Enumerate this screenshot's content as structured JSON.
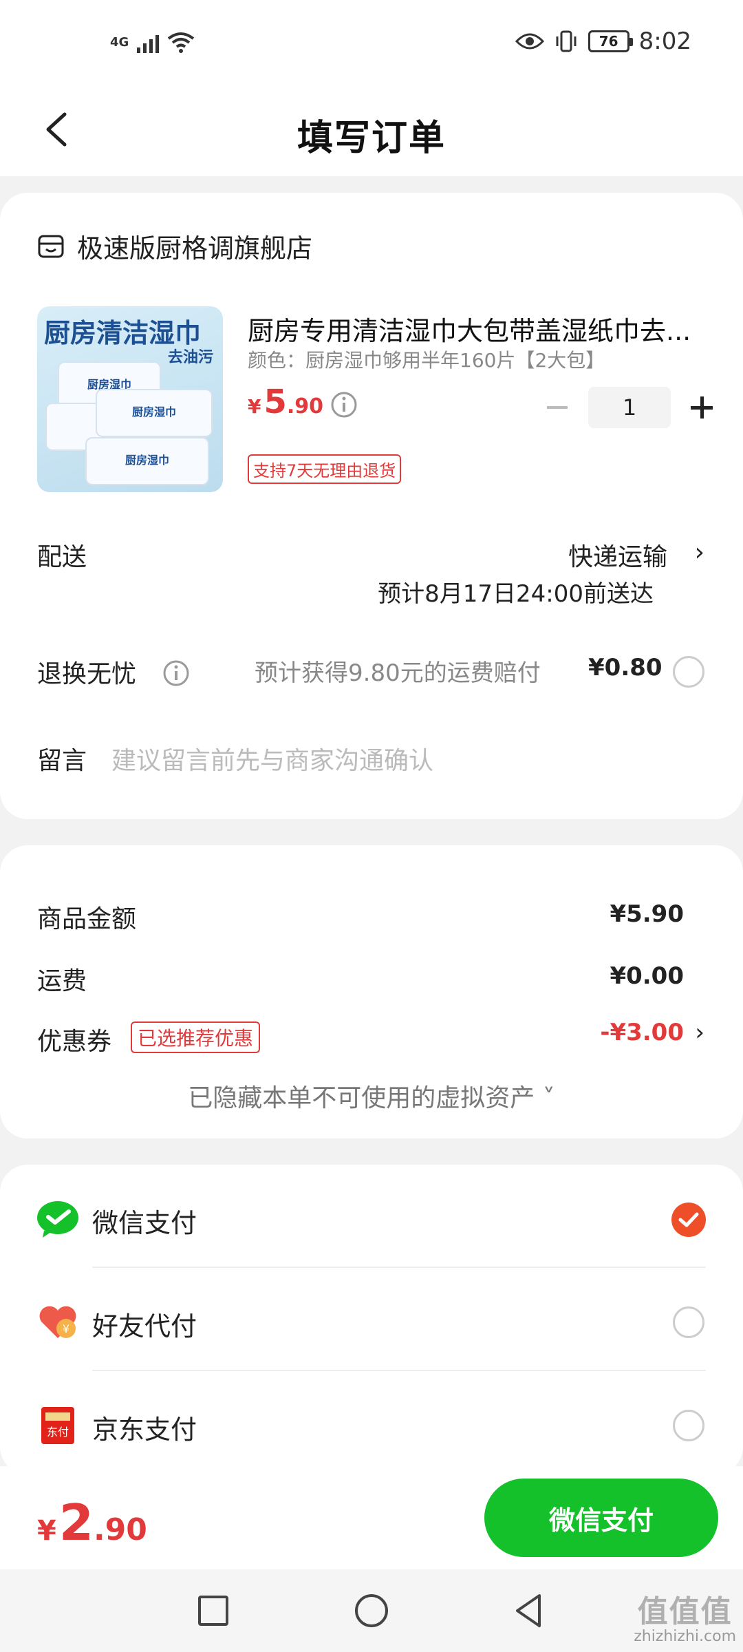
{
  "status_bar": {
    "network": "4G",
    "battery": "76",
    "time": "8:02"
  },
  "header": {
    "title": "填写订单"
  },
  "store": {
    "name": "极速版厨格调旗舰店"
  },
  "product": {
    "image_text_main": "厨房清洁湿巾",
    "image_text_sub": "去油污",
    "image_pack_label": "厨房湿巾",
    "name": "厨房专用清洁湿巾大包带盖湿纸巾去...",
    "spec": "颜色：厨房湿巾够用半年160片【2大包】",
    "price_currency": "¥",
    "price_int": "5",
    "price_dec": ".90",
    "quantity": "1",
    "return_badge": "支持7天无理由退货"
  },
  "delivery": {
    "label": "配送",
    "method": "快递运输",
    "eta": "预计8月17日24:00前送达"
  },
  "return_insurance": {
    "label": "退换无忧",
    "desc": "预计获得9.80元的运费赔付",
    "price": "¥0.80"
  },
  "message": {
    "label": "留言",
    "placeholder": "建议留言前先与商家沟通确认"
  },
  "summary": {
    "goods_label": "商品金额",
    "goods_value": "¥5.90",
    "shipping_label": "运费",
    "shipping_value": "¥0.00",
    "coupon_label": "优惠券",
    "coupon_badge": "已选推荐优惠",
    "coupon_value": "-¥3.00",
    "hidden_note": "已隐藏本单不可使用的虚拟资产 ˅"
  },
  "payment": {
    "wechat_label": "微信支付",
    "friend_label": "好友代付",
    "jd_label": "京东支付",
    "jd_icon_text": "东付",
    "selected": "wechat"
  },
  "footer": {
    "total_currency": "¥",
    "total_int": "2",
    "total_dec": ".90",
    "pay_button": "微信支付"
  },
  "watermark": {
    "big": "值值值",
    "small": "zhizhizhi.com"
  },
  "colors": {
    "accent_red": "#e23a3a",
    "pay_green": "#14c12a",
    "check_orange": "#ee4f28"
  }
}
